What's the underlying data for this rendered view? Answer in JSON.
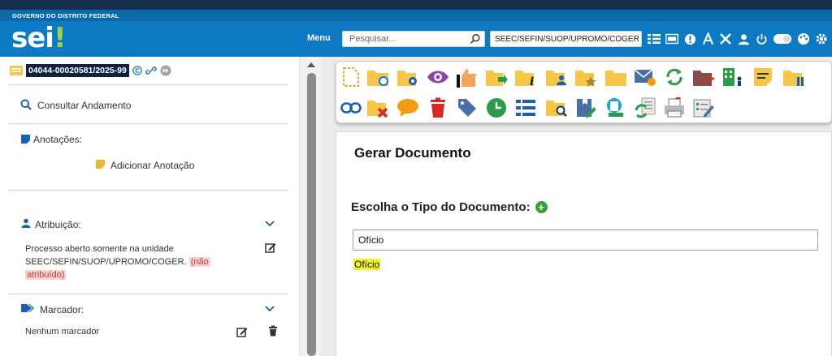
{
  "header": {
    "gov_title": "GOVERNO DO DISTRITO FEDERAL",
    "logo_text": "sei",
    "logo_mark": "!",
    "menu_label": "Menu",
    "search_placeholder": "Pesquisar...",
    "unit": "SEEC/SEFIN/SUOP/UPROMO/COGER",
    "icons": [
      "list-icon",
      "keyboard-123-icon",
      "bell-icon",
      "font-size-icon",
      "tools-icon",
      "user-icon",
      "power-icon",
      "toggle-icon",
      "palette-icon",
      "settings-gear-icon"
    ],
    "colors": {
      "top_strip": "#17304f",
      "gov_bar": "#0d6aa8",
      "header": "#0e7ac4",
      "logo_accent": "#9bd34a"
    }
  },
  "sidebar": {
    "process_number": "04044-00020581/2025-99",
    "consultar": "Consultar Andamento",
    "anotacoes_label": "Anotações:",
    "adicionar_anotacao": "Adicionar Anotação",
    "atribuicao_label": "Atribuição:",
    "atribuicao_text_1": "Processo aberto somente na unidade",
    "atribuicao_text_2": "SEEC/SEFIN/SUOP/UPROMO/COGER.",
    "atribuicao_badge_1": "(não",
    "atribuicao_badge_2": "atribuído)",
    "marcador_label": "Marcador:",
    "marcador_value": "Nenhum marcador"
  },
  "toolbar": {
    "row1": [
      "new-document-icon",
      "folder-sync-icon",
      "folder-settings-icon",
      "eye-icon",
      "thumbs-up-icon",
      "folder-forward-icon",
      "folder-info-icon",
      "folder-user-icon",
      "folder-star-icon",
      "folder-icon",
      "email-icon",
      "refresh-icon",
      "folder-add-icon",
      "building-user-icon",
      "note-icon",
      "folder-pause-icon"
    ],
    "row2": [
      "link-icon",
      "folder-remove-icon",
      "comment-icon",
      "trash-icon",
      "tag-icon",
      "clock-icon",
      "list-icon",
      "folder-search-icon",
      "folder-edit-icon",
      "document-scan-icon",
      "document-refresh-icon",
      "printer-icon",
      "checklist-edit-icon"
    ]
  },
  "main": {
    "title": "Gerar Documento",
    "choose_label": "Escolha o Tipo do Documento:",
    "filter_value": "Ofício",
    "options": [
      "Ofício"
    ]
  }
}
